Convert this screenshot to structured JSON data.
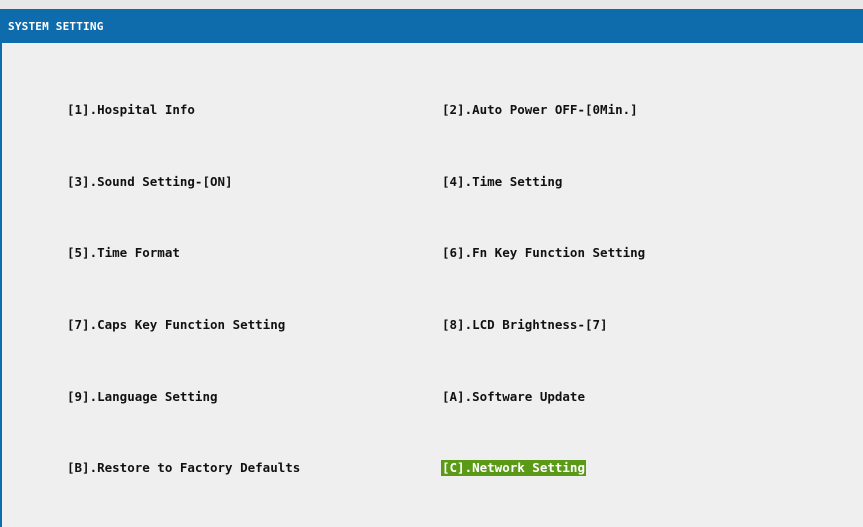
{
  "window": {
    "title": "SYSTEM SETTING"
  },
  "menu": {
    "items": [
      {
        "label": "[1].Hospital Info"
      },
      {
        "label": "[2].Auto Power OFF-[0Min.]"
      },
      {
        "label": "[3].Sound Setting-[ON]"
      },
      {
        "label": "[4].Time Setting"
      },
      {
        "label": "[5].Time Format"
      },
      {
        "label": "[6].Fn Key Function Setting"
      },
      {
        "label": "[7].Caps Key Function Setting"
      },
      {
        "label": "[8].LCD Brightness-[7]"
      },
      {
        "label": "[9].Language Setting"
      },
      {
        "label": "[A].Software Update"
      },
      {
        "label": "[B].Restore to Factory Defaults"
      },
      {
        "label": "[C].Network Setting",
        "selected": true
      }
    ]
  },
  "colors": {
    "titlebar": "#0e6cad",
    "background": "#efefef",
    "selection": "#5a9a16"
  }
}
